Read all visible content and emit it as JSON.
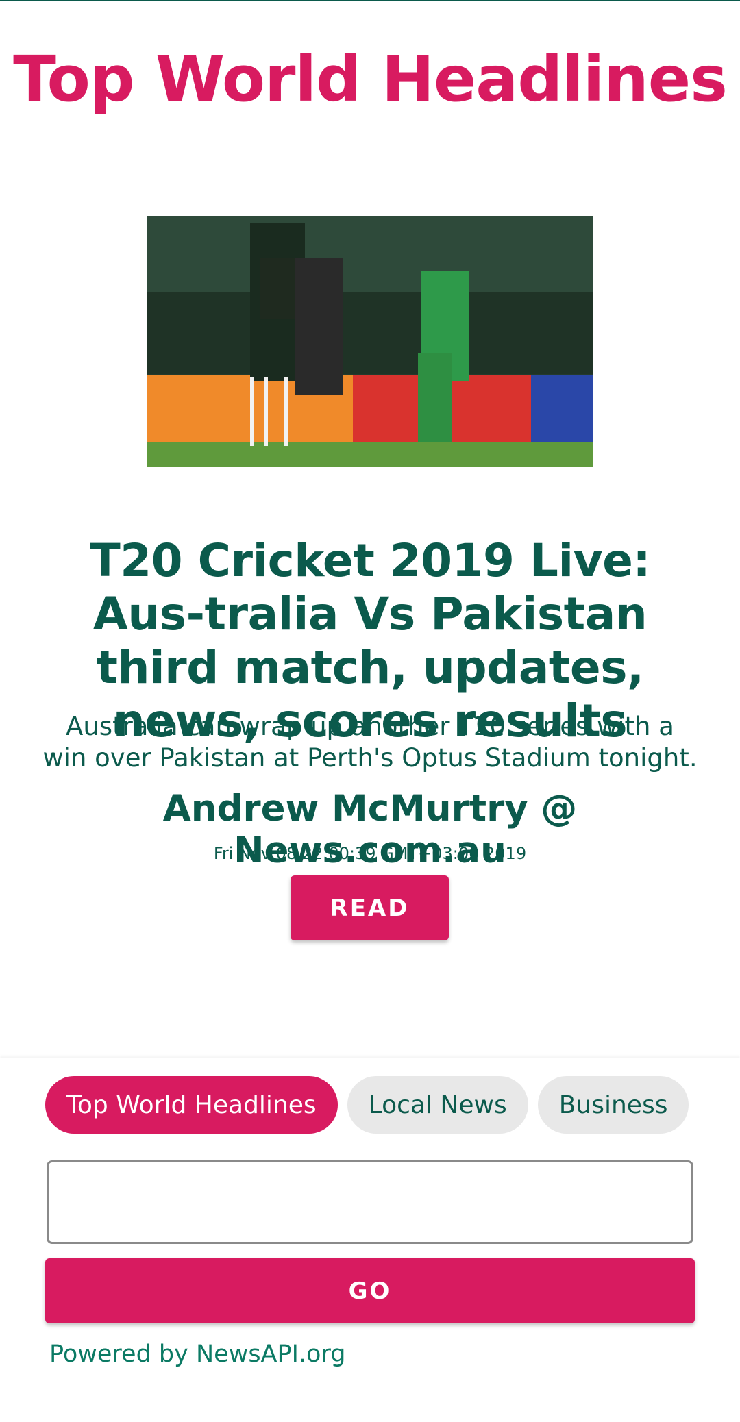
{
  "app": {
    "title": "Top World Headlines"
  },
  "article": {
    "image_alt": "Cricket players celebrating on the field",
    "headline": "T20 Cricket 2019 Live: Aus-tralia Vs Pakistan third match, updates, news, scores results",
    "summary": "Australia can wrap up another T20 series with a win over Pakistan at Perth's Optus Stadium tonight.",
    "author_source": "Andrew McMurtry @ News.com.au",
    "published": "Fri Nov 08 22:00:39 GMT+03:00 2019",
    "read_label": "READ"
  },
  "categories": {
    "items": [
      {
        "label": "Top World Headlines",
        "active": true
      },
      {
        "label": "Local News",
        "active": false
      },
      {
        "label": "Business",
        "active": false
      },
      {
        "label": "",
        "active": false
      }
    ]
  },
  "search": {
    "value": "",
    "placeholder": ""
  },
  "go_label": "GO",
  "footer": {
    "powered_by": "Powered by NewsAPI.org"
  },
  "colors": {
    "accent": "#d81b60",
    "text": "#0b5a4c",
    "chip_inactive": "#e8e8e8"
  }
}
